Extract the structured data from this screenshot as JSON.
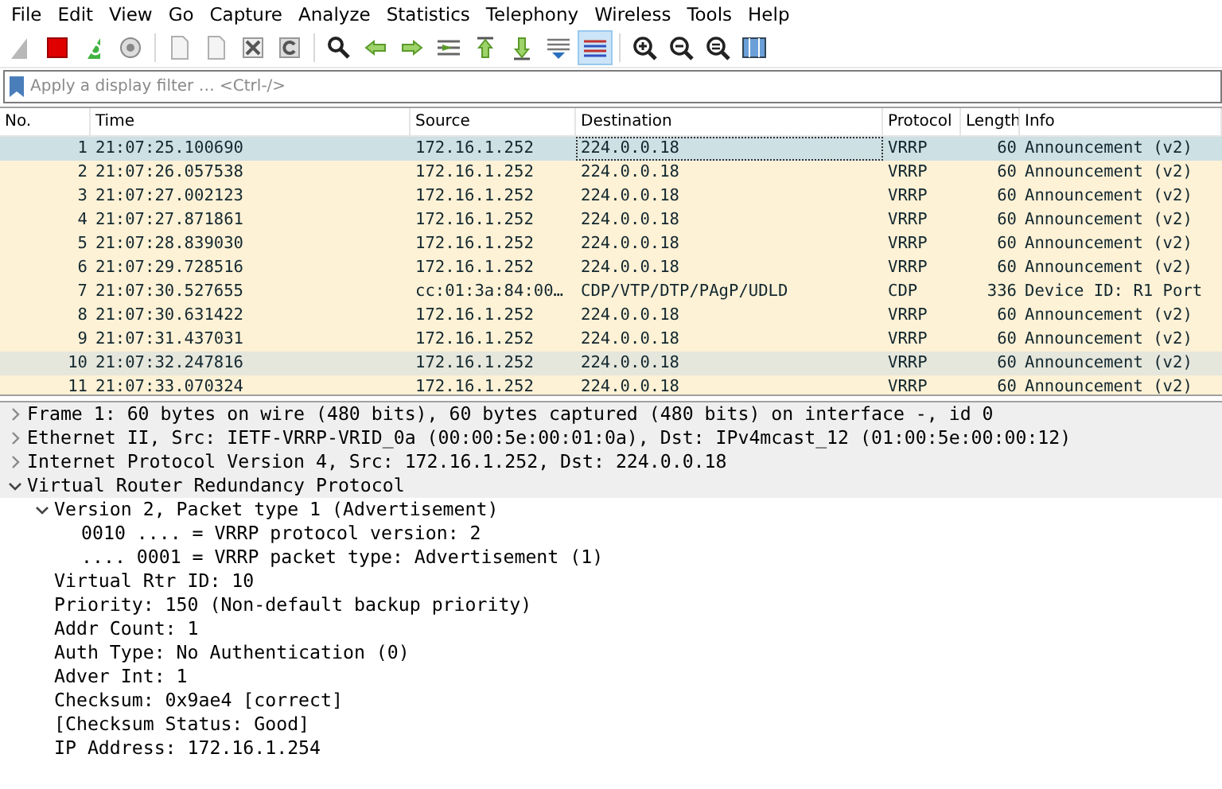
{
  "menu": [
    "File",
    "Edit",
    "View",
    "Go",
    "Capture",
    "Analyze",
    "Statistics",
    "Telephony",
    "Wireless",
    "Tools",
    "Help"
  ],
  "toolbar": [
    {
      "kind": "fin",
      "on": false
    },
    {
      "kind": "stop",
      "on": false
    },
    {
      "kind": "restart",
      "on": false
    },
    {
      "kind": "options",
      "on": false
    },
    {
      "kind": "sep"
    },
    {
      "kind": "file",
      "on": false
    },
    {
      "kind": "file",
      "on": false
    },
    {
      "kind": "close",
      "on": false
    },
    {
      "kind": "reload",
      "on": false
    },
    {
      "kind": "sep"
    },
    {
      "kind": "search",
      "on": false
    },
    {
      "kind": "back",
      "on": false
    },
    {
      "kind": "forward",
      "on": false
    },
    {
      "kind": "goto",
      "on": false
    },
    {
      "kind": "first",
      "on": false
    },
    {
      "kind": "last",
      "on": false
    },
    {
      "kind": "autoscroll",
      "on": false
    },
    {
      "kind": "colorize",
      "on": true
    },
    {
      "kind": "sep"
    },
    {
      "kind": "zoomin",
      "on": false
    },
    {
      "kind": "zoomout",
      "on": false
    },
    {
      "kind": "zoomreset",
      "on": false
    },
    {
      "kind": "resize",
      "on": false
    }
  ],
  "filter": {
    "placeholder": "Apply a display filter … <Ctrl-/>"
  },
  "table": {
    "columns": [
      "No.",
      "Time",
      "Source",
      "Destination",
      "Protocol",
      "Length",
      "Info"
    ],
    "rows": [
      {
        "cells": [
          "1",
          "21:07:25.100690",
          "172.16.1.252",
          "224.0.0.18",
          "VRRP",
          "60",
          "Announcement (v2)"
        ],
        "selected": true
      },
      {
        "cells": [
          "2",
          "21:07:26.057538",
          "172.16.1.252",
          "224.0.0.18",
          "VRRP",
          "60",
          "Announcement (v2)"
        ],
        "selected": false,
        "color": "#fdf1d6"
      },
      {
        "cells": [
          "3",
          "21:07:27.002123",
          "172.16.1.252",
          "224.0.0.18",
          "VRRP",
          "60",
          "Announcement (v2)"
        ],
        "selected": false,
        "color": "#fdf1d6"
      },
      {
        "cells": [
          "4",
          "21:07:27.871861",
          "172.16.1.252",
          "224.0.0.18",
          "VRRP",
          "60",
          "Announcement (v2)"
        ],
        "selected": false,
        "color": "#fdf1d6"
      },
      {
        "cells": [
          "5",
          "21:07:28.839030",
          "172.16.1.252",
          "224.0.0.18",
          "VRRP",
          "60",
          "Announcement (v2)"
        ],
        "selected": false,
        "color": "#fdf1d6"
      },
      {
        "cells": [
          "6",
          "21:07:29.728516",
          "172.16.1.252",
          "224.0.0.18",
          "VRRP",
          "60",
          "Announcement (v2)"
        ],
        "selected": false,
        "color": "#fdf1d6"
      },
      {
        "cells": [
          "7",
          "21:07:30.527655",
          "cc:01:3a:84:00…",
          "CDP/VTP/DTP/PAgP/UDLD",
          "CDP",
          "336",
          "Device ID: R1  Port"
        ],
        "selected": false,
        "color": "#fdf1d6"
      },
      {
        "cells": [
          "8",
          "21:07:30.631422",
          "172.16.1.252",
          "224.0.0.18",
          "VRRP",
          "60",
          "Announcement (v2)"
        ],
        "selected": false,
        "color": "#fdf1d6"
      },
      {
        "cells": [
          "9",
          "21:07:31.437031",
          "172.16.1.252",
          "224.0.0.18",
          "VRRP",
          "60",
          "Announcement (v2)"
        ],
        "selected": false,
        "color": "#fdf1d6"
      },
      {
        "cells": [
          "10",
          "21:07:32.247816",
          "172.16.1.252",
          "224.0.0.18",
          "VRRP",
          "60",
          "Announcement (v2)"
        ],
        "selected": false,
        "color": "#e5e6dc"
      },
      {
        "cells": [
          "11",
          "21:07:33.070324",
          "172.16.1.252",
          "224.0.0.18",
          "VRRP",
          "60",
          "Announcement (v2)"
        ],
        "selected": false,
        "color": "#fdf1d6"
      }
    ]
  },
  "details": [
    {
      "text": "Frame 1: 60 bytes on wire (480 bits), 60 bytes captured (480 bits) on interface -, id 0",
      "expanded": false
    },
    {
      "text": "Ethernet II, Src: IETF-VRRP-VRID_0a (00:00:5e:00:01:0a), Dst: IPv4mcast_12 (01:00:5e:00:00:12)",
      "expanded": false
    },
    {
      "text": "Internet Protocol Version 4, Src: 172.16.1.252, Dst: 224.0.0.18",
      "expanded": false
    },
    {
      "text": "Virtual Router Redundancy Protocol",
      "expanded": true,
      "children": [
        {
          "text": "Version 2, Packet type 1 (Advertisement)",
          "expanded": true,
          "children": [
            {
              "text": "0010 .... = VRRP protocol version: 2"
            },
            {
              "text": ".... 0001 = VRRP packet type: Advertisement (1)"
            }
          ]
        },
        {
          "text": "Virtual Rtr ID: 10"
        },
        {
          "text": "Priority: 150 (Non-default backup priority)"
        },
        {
          "text": "Addr Count: 1"
        },
        {
          "text": "Auth Type: No Authentication (0)"
        },
        {
          "text": "Adver Int: 1"
        },
        {
          "text": "Checksum: 0x9ae4 [correct]"
        },
        {
          "text": "[Checksum Status: Good]"
        },
        {
          "text": "IP Address: 172.16.1.254"
        }
      ]
    }
  ]
}
